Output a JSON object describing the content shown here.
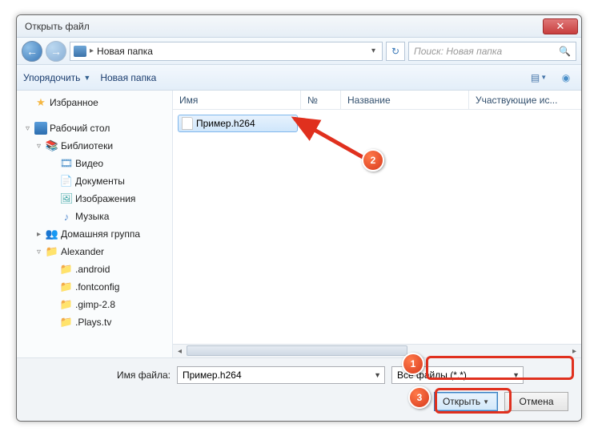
{
  "window": {
    "title": "Открыть файл"
  },
  "nav": {
    "breadcrumb": "Новая папка",
    "search_placeholder": "Поиск: Новая папка"
  },
  "toolbar": {
    "organize": "Упорядочить",
    "new_folder": "Новая папка"
  },
  "columns": {
    "name": "Имя",
    "number": "№",
    "title": "Название",
    "participants": "Участвующие ис..."
  },
  "sidebar": [
    {
      "label": "Избранное",
      "icon": "star",
      "depth": 0,
      "tw": ""
    },
    {
      "label": "Рабочий стол",
      "icon": "desk",
      "depth": 0,
      "tw": "▿"
    },
    {
      "label": "Библиотеки",
      "icon": "lib",
      "depth": 1,
      "tw": "▿"
    },
    {
      "label": "Видео",
      "icon": "vid",
      "depth": 2,
      "tw": ""
    },
    {
      "label": "Документы",
      "icon": "doc",
      "depth": 2,
      "tw": ""
    },
    {
      "label": "Изображения",
      "icon": "img",
      "depth": 2,
      "tw": ""
    },
    {
      "label": "Музыка",
      "icon": "mus",
      "depth": 2,
      "tw": ""
    },
    {
      "label": "Домашняя группа",
      "icon": "home",
      "depth": 1,
      "tw": "▸"
    },
    {
      "label": "Alexander",
      "icon": "folder",
      "depth": 1,
      "tw": "▿"
    },
    {
      "label": ".android",
      "icon": "folder",
      "depth": 2,
      "tw": ""
    },
    {
      "label": ".fontconfig",
      "icon": "folder",
      "depth": 2,
      "tw": ""
    },
    {
      "label": ".gimp-2.8",
      "icon": "folder",
      "depth": 2,
      "tw": ""
    },
    {
      "label": ".Plays.tv",
      "icon": "folder",
      "depth": 2,
      "tw": ""
    }
  ],
  "files": [
    {
      "name": "Пример.h264"
    }
  ],
  "footer": {
    "filename_label": "Имя файла:",
    "filename_value": "Пример.h264",
    "filetype_value": "Все файлы (*.*)",
    "open": "Открыть",
    "cancel": "Отмена"
  },
  "annotations": {
    "step1": "1",
    "step2": "2",
    "step3": "3"
  }
}
